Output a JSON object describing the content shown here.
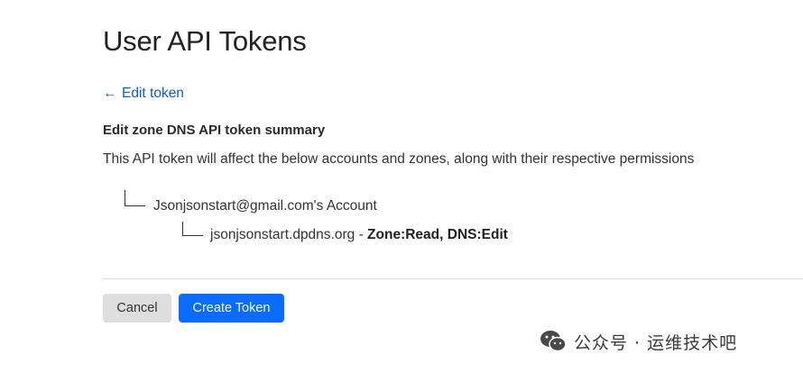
{
  "page": {
    "title": "User API Tokens",
    "back_arrow": "←",
    "back_link": "Edit token"
  },
  "summary": {
    "heading": "Edit zone DNS API token summary",
    "description": "This API token will affect the below accounts and zones, along with their respective permissions",
    "account": "Jsonjsonstart@gmail.com's Account",
    "zone": "jsonjsonstart.dpdns.org",
    "separator": " - ",
    "permissions": "Zone:Read, DNS:Edit"
  },
  "actions": {
    "cancel_label": "Cancel",
    "create_label": "Create Token"
  },
  "watermark": {
    "text": "公众号 · 运维技术吧"
  },
  "colors": {
    "link": "#0a5fd1",
    "primary_button": "#0a6cff",
    "secondary_button": "#dedede"
  }
}
